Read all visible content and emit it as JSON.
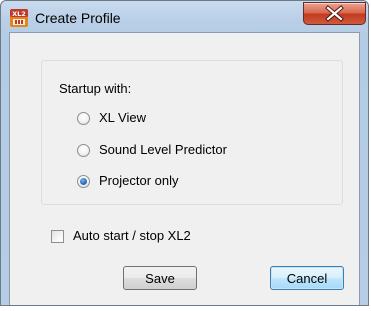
{
  "window": {
    "title": "Create Profile",
    "app_icon": "xl2-app-icon",
    "app_icon_text": "XL2",
    "close_glyph": "close-icon"
  },
  "startup_group": {
    "label": "Startup with:",
    "options": [
      {
        "label": "XL View",
        "selected": false
      },
      {
        "label": "Sound Level Predictor",
        "selected": false
      },
      {
        "label": "Projector only",
        "selected": true
      }
    ]
  },
  "auto_start": {
    "label": "Auto start / stop XL2",
    "checked": false
  },
  "buttons": {
    "save_label": "Save",
    "cancel_label": "Cancel"
  },
  "colors": {
    "title_bar": "#b9cfe7",
    "close_button": "#c2391f",
    "dialog_background": "#f0f0f0",
    "radio_selected": "#2a6fbf",
    "default_button_border": "#3c7fb1"
  }
}
